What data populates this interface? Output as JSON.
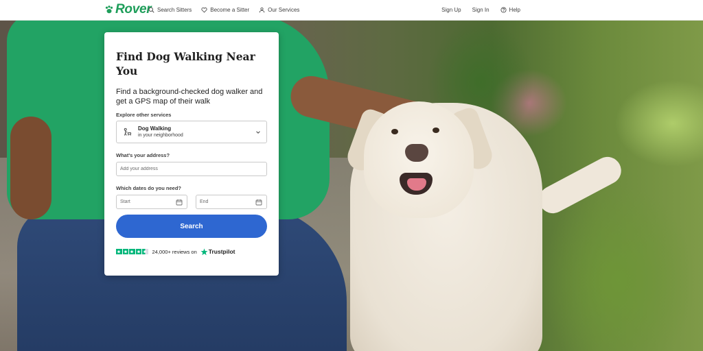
{
  "nav": {
    "logo": "Rover",
    "search_sitters": "Search Sitters",
    "become_sitter": "Become a Sitter",
    "our_services": "Our Services",
    "sign_up": "Sign Up",
    "sign_in": "Sign In",
    "help": "Help"
  },
  "card": {
    "title": "Find Dog Walking Near You",
    "subtitle": "Find a background-checked dog walker and get a GPS map of their walk",
    "services_label": "Explore other services",
    "service": {
      "name": "Dog Walking",
      "description": "in your neighborhood"
    },
    "address_label": "What's your address?",
    "address_placeholder": "Add your address",
    "address_value": "",
    "dates_label": "Which dates do you need?",
    "start_placeholder": "Start",
    "end_placeholder": "End",
    "search_label": "Search",
    "reviews_text": "24,000+ reviews on",
    "trustpilot": "Trustpilot",
    "rating_stars": 4.5
  },
  "colors": {
    "brand_green": "#1e9e5a",
    "button_blue": "#2e67d1",
    "trustpilot_green": "#00b67a"
  },
  "icons": {
    "search": "search-icon",
    "heart": "heart-icon",
    "services": "services-icon",
    "help": "help-circle-icon",
    "dog_walking": "dog-walking-icon",
    "dropdown": "chevron-down-icon",
    "calendar": "calendar-icon",
    "trustpilot_star": "trustpilot-star-icon"
  }
}
